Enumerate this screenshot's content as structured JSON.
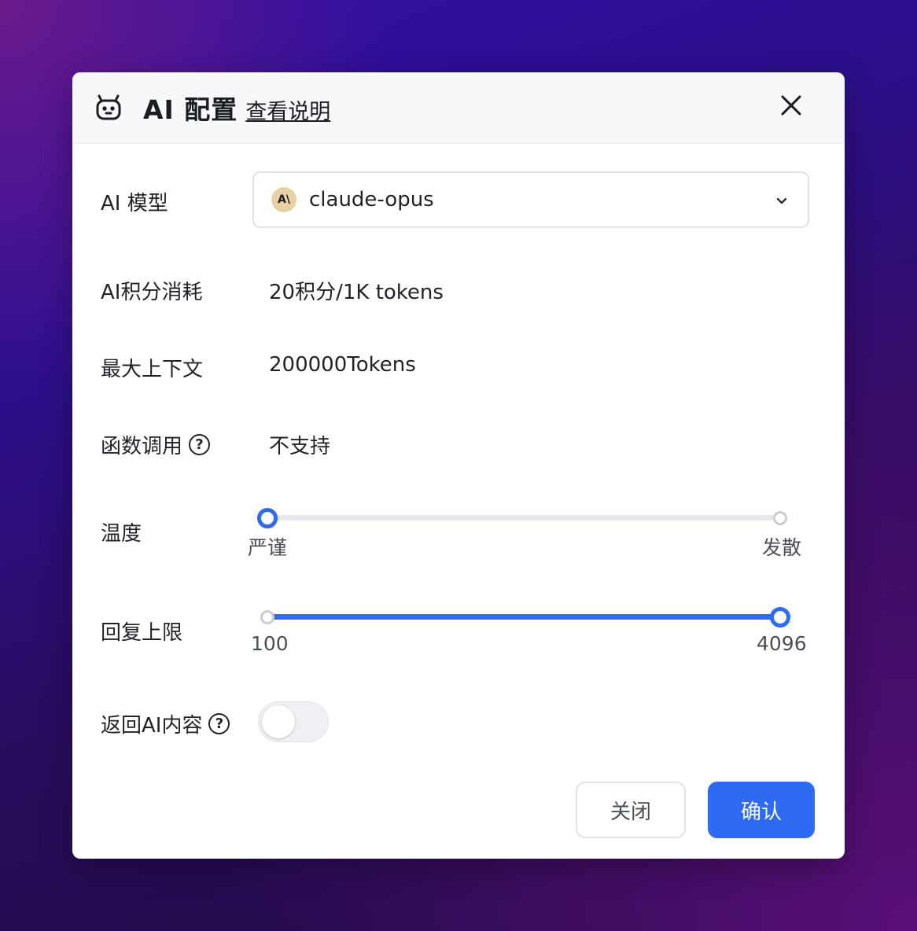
{
  "header": {
    "title": "AI 配置",
    "doc_link": "查看说明",
    "icons": {
      "robot": "robot-icon",
      "close": "close-icon"
    }
  },
  "fields": {
    "model": {
      "label": "AI 模型",
      "value": "claude-opus",
      "icon_text": "A\\"
    },
    "points": {
      "label": "AI积分消耗",
      "value": "20积分/1K tokens"
    },
    "context": {
      "label": "最大上下文",
      "value": "200000Tokens"
    },
    "function_call": {
      "label": "函数调用",
      "value": "不支持"
    },
    "temperature": {
      "label": "温度",
      "min_label": "严谨",
      "max_label": "发散",
      "value_fraction": 0
    },
    "max_tokens": {
      "label": "回复上限",
      "min_label": "100",
      "max_label": "4096",
      "value_fraction": 1
    },
    "return_ai": {
      "label": "返回AI内容",
      "enabled": false
    }
  },
  "help_glyph": "?",
  "buttons": {
    "close": "关闭",
    "confirm": "确认"
  },
  "colors": {
    "accent": "#2f6bf2",
    "dialog_bg": "#ffffff",
    "header_bg": "#f7f8fa"
  }
}
